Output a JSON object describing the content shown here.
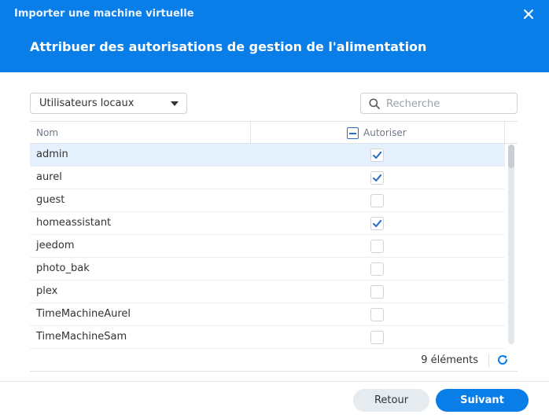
{
  "window": {
    "title": "Importer une machine virtuelle"
  },
  "wizard": {
    "title": "Attribuer des autorisations de gestion de l'alimentation"
  },
  "filter": {
    "selected": "Utilisateurs locaux"
  },
  "search": {
    "placeholder": "Recherche"
  },
  "grid": {
    "columns": {
      "name": "Nom",
      "allow": "Autoriser"
    },
    "rows": [
      {
        "name": "admin",
        "allowed": true,
        "selected": true
      },
      {
        "name": "aurel",
        "allowed": true,
        "selected": false
      },
      {
        "name": "guest",
        "allowed": false,
        "selected": false
      },
      {
        "name": "homeassistant",
        "allowed": true,
        "selected": false
      },
      {
        "name": "jeedom",
        "allowed": false,
        "selected": false
      },
      {
        "name": "photo_bak",
        "allowed": false,
        "selected": false
      },
      {
        "name": "plex",
        "allowed": false,
        "selected": false
      },
      {
        "name": "TimeMachineAurel",
        "allowed": false,
        "selected": false
      },
      {
        "name": "TimeMachineSam",
        "allowed": false,
        "selected": false
      }
    ],
    "count_label": "9 éléments"
  },
  "buttons": {
    "back": "Retour",
    "next": "Suivant"
  },
  "colors": {
    "accent": "#0a7ee8",
    "check": "#2a6cc4",
    "selected_row": "#e4f0fc"
  },
  "icons": {
    "close": "close-icon",
    "search": "search-icon",
    "refresh": "refresh-icon",
    "caret": "chevron-down-icon"
  }
}
